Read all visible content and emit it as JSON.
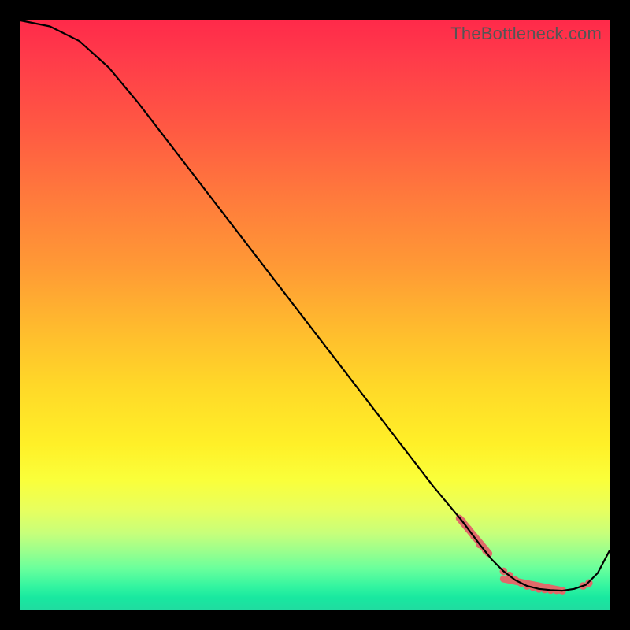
{
  "watermark": "TheBottleneck.com",
  "chart_data": {
    "type": "line",
    "title": "",
    "xlabel": "",
    "ylabel": "",
    "xlim": [
      0,
      100
    ],
    "ylim": [
      0,
      100
    ],
    "grid": false,
    "legend": false,
    "series": [
      {
        "name": "bottleneck-curve",
        "x": [
          0,
          5,
          10,
          15,
          20,
          25,
          30,
          35,
          40,
          45,
          50,
          55,
          60,
          65,
          70,
          75,
          78,
          80,
          82,
          84,
          86,
          88,
          90,
          92,
          94,
          96,
          98,
          100
        ],
        "y": [
          100,
          99,
          96.5,
          92,
          86,
          79.5,
          73,
          66.5,
          60,
          53.5,
          47,
          40.5,
          34,
          27.5,
          21,
          15,
          11,
          8.5,
          6.5,
          5,
          4,
          3.5,
          3.3,
          3.2,
          3.5,
          4.2,
          6.2,
          10
        ]
      }
    ],
    "markers": {
      "name": "highlight-cluster",
      "color": "#e06a6a",
      "points_x": [
        75,
        76,
        77,
        78,
        79,
        82,
        83,
        84,
        85,
        86,
        87,
        88,
        89,
        90,
        91,
        92,
        95.5,
        96.5
      ],
      "points_y": [
        15,
        13.7,
        12.4,
        11,
        10,
        6.5,
        5.8,
        5,
        4.5,
        4,
        3.8,
        3.5,
        3.4,
        3.3,
        3.25,
        3.2,
        4.0,
        4.5
      ]
    },
    "gradient_stops": [
      {
        "pos": 0.0,
        "color": "#ff2a4a"
      },
      {
        "pos": 0.5,
        "color": "#ffd828"
      },
      {
        "pos": 0.8,
        "color": "#faff3a"
      },
      {
        "pos": 1.0,
        "color": "#20dca0"
      }
    ]
  }
}
